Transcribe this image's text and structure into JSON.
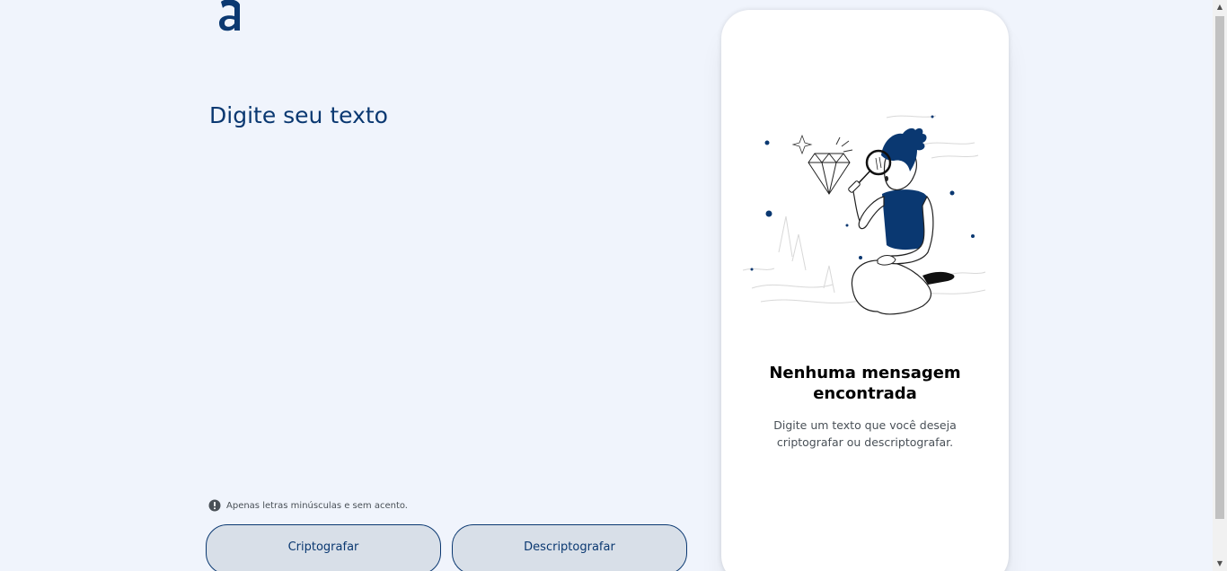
{
  "input": {
    "placeholder": "Digite seu texto",
    "value": ""
  },
  "hint": {
    "icon": "info-icon",
    "text": "Apenas letras minúsculas e sem acento."
  },
  "buttons": {
    "encrypt_label": "Criptografar",
    "decrypt_label": "Descriptografar"
  },
  "output_panel": {
    "title": "Nenhuma mensagem encontrada",
    "message": "Digite um texto que você deseja criptografar ou descriptografar."
  },
  "colors": {
    "background": "#f0f4fc",
    "primary": "#0a3871",
    "button_bg": "#d8dfe8",
    "panel_bg": "#ffffff",
    "muted_text": "#495057"
  },
  "icons": {
    "logo": "alura-a-logo",
    "illustration": "person-with-magnifier-and-diamond"
  },
  "scrollbar": {
    "up": "▲",
    "down": "▼"
  }
}
